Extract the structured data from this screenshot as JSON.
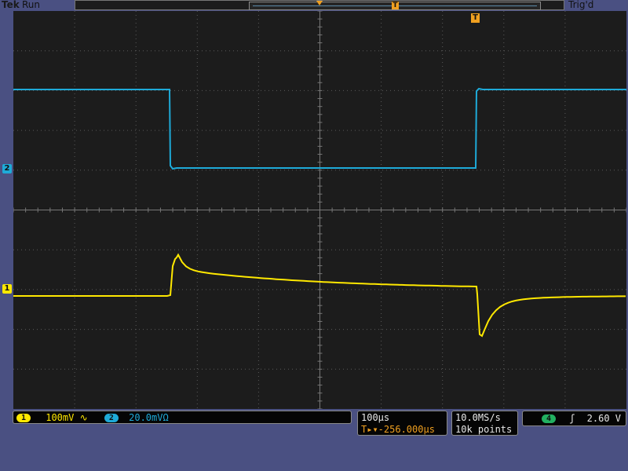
{
  "status": {
    "brand": "Tek",
    "run_state": "Run",
    "trigger_state": "Trig'd"
  },
  "markers": {
    "trigger_pos": "T",
    "ch2": "2",
    "ch1": "1"
  },
  "channel_settings": {
    "ch1": {
      "num": "1",
      "scale": "100mV",
      "coupling": "∿",
      "color": "#ffe800"
    },
    "ch2": {
      "num": "2",
      "scale": "20.0mVΩ",
      "color": "#1eaad8"
    }
  },
  "horizontal": {
    "timebase": "100µs",
    "delay": "T▸▾-256.000µs"
  },
  "acquisition": {
    "sample_rate": "10.0MS/s",
    "record_length": "10k points"
  },
  "trigger": {
    "source": "4",
    "slope": "ʃ",
    "level": "2.60 V",
    "source_color": "#22b060"
  }
}
